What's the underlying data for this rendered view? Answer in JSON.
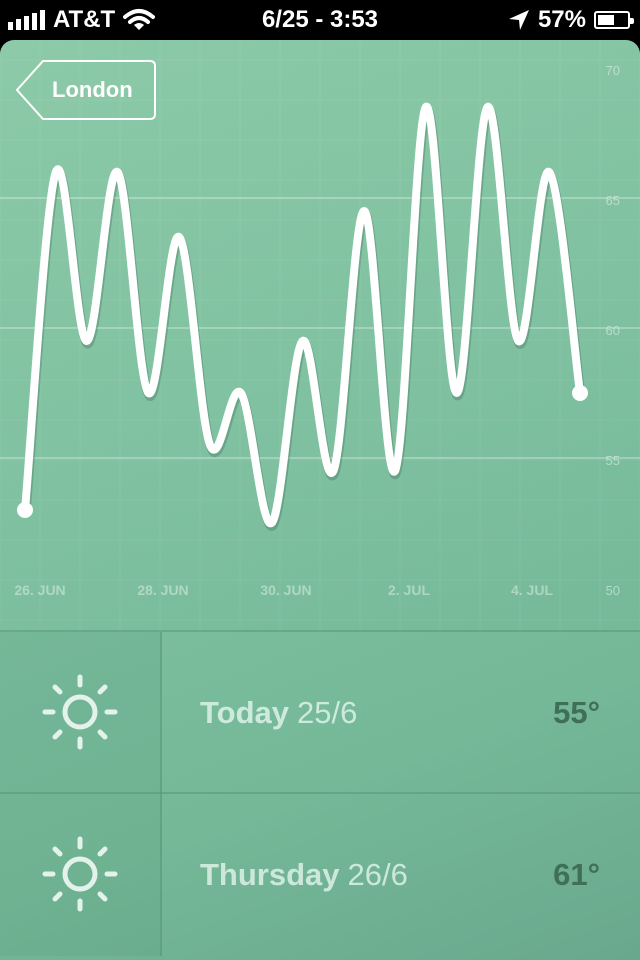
{
  "status_bar": {
    "carrier": "AT&T",
    "datetime": "6/25 - 3:53",
    "battery": "57%",
    "battery_level": 0.57,
    "signal_icon": "signal-bars-icon",
    "wifi_icon": "wifi-icon",
    "location_icon": "location-arrow-icon"
  },
  "header": {
    "back_label": "London",
    "back_icon": "back-tag-icon"
  },
  "colors": {
    "background": "#7ec0a0",
    "line": "#ffffff",
    "temp_text": "#3f6f57"
  },
  "chart_data": {
    "type": "line",
    "x_tick_labels": [
      "26. JUN",
      "28. JUN",
      "30. JUN",
      "2. JUL",
      "4. JUL"
    ],
    "y_tick_labels": [
      "70",
      "65",
      "60",
      "55",
      "50"
    ],
    "ylim": [
      50,
      70
    ],
    "grid": true,
    "smooth": true,
    "series": [
      {
        "values": [
          53,
          66,
          59.5,
          66,
          57.5,
          63.5,
          55.5,
          57.5,
          52.5,
          59.5,
          54.5,
          64.5,
          54.5,
          68.5,
          57.5,
          68.5,
          59.5,
          66,
          57.5
        ]
      }
    ]
  },
  "forecast": [
    {
      "day": "Today",
      "date": "25/6",
      "temp": "55°",
      "icon": "sun-icon"
    },
    {
      "day": "Thursday",
      "date": "26/6",
      "temp": "61°",
      "icon": "sun-icon"
    }
  ]
}
